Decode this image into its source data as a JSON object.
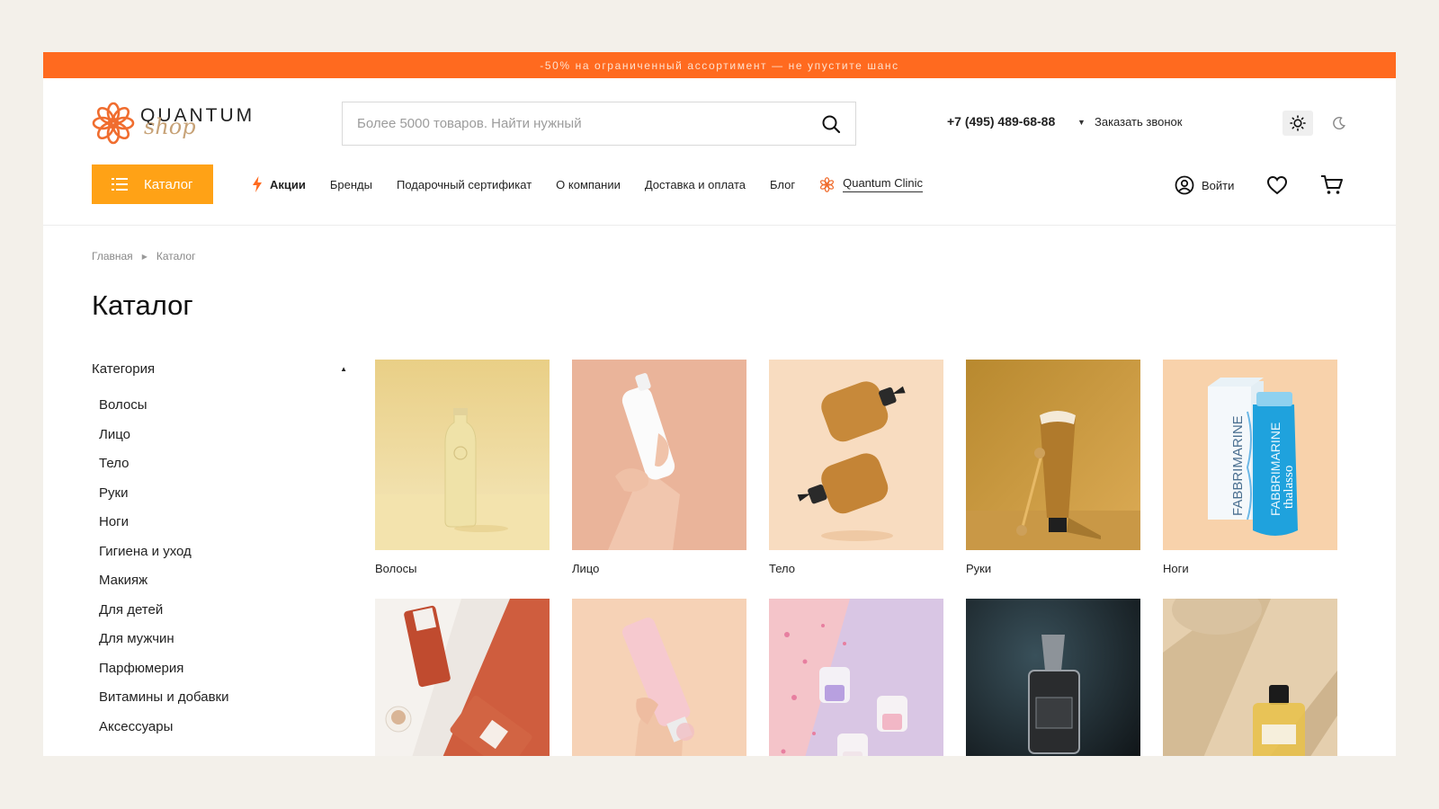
{
  "promo": {
    "text": "-50% на ограниченный ассортимент — не упустите шанс"
  },
  "header": {
    "logo_word": "QUANTUM",
    "logo_sub": "shop",
    "search": {
      "placeholder": "Более 5000 товаров. Найти нужный",
      "value": ""
    },
    "phone": "+7 (495) 489-68-88",
    "callback": "Заказать звонок"
  },
  "nav": {
    "catalog_label": "Каталог",
    "items": [
      {
        "label": "Акции"
      },
      {
        "label": "Бренды"
      },
      {
        "label": "Подарочный сертификат"
      },
      {
        "label": "О компании"
      },
      {
        "label": "Доставка и оплата"
      },
      {
        "label": "Блог"
      },
      {
        "label": "Quantum Clinic"
      }
    ],
    "login_label": "Войти"
  },
  "breadcrumb": [
    "Главная",
    "Каталог"
  ],
  "page_title": "Каталог",
  "filter": {
    "heading": "Категория",
    "items": [
      "Волосы",
      "Лицо",
      "Тело",
      "Руки",
      "Ноги",
      "Гигиена и уход",
      "Макияж",
      "Для детей",
      "Для мужчин",
      "Парфюмерия",
      "Витамины и добавки",
      "Аксессуары"
    ]
  },
  "categories": [
    {
      "label": "Волосы"
    },
    {
      "label": "Лицо"
    },
    {
      "label": "Тело"
    },
    {
      "label": "Руки"
    },
    {
      "label": "Ноги",
      "brand": "FABBRIMARINE",
      "sub": "thalasso"
    },
    {
      "label": ""
    },
    {
      "label": ""
    },
    {
      "label": ""
    },
    {
      "label": ""
    },
    {
      "label": ""
    }
  ],
  "colors": {
    "promo": "#ff6a1f",
    "accent": "#ffa216",
    "logo": "#f06d2f"
  },
  "icons": [
    "search-icon",
    "sun-icon",
    "moon-icon",
    "menu-icon",
    "bolt-icon",
    "flower-icon",
    "user-icon",
    "heart-icon",
    "cart-icon"
  ]
}
